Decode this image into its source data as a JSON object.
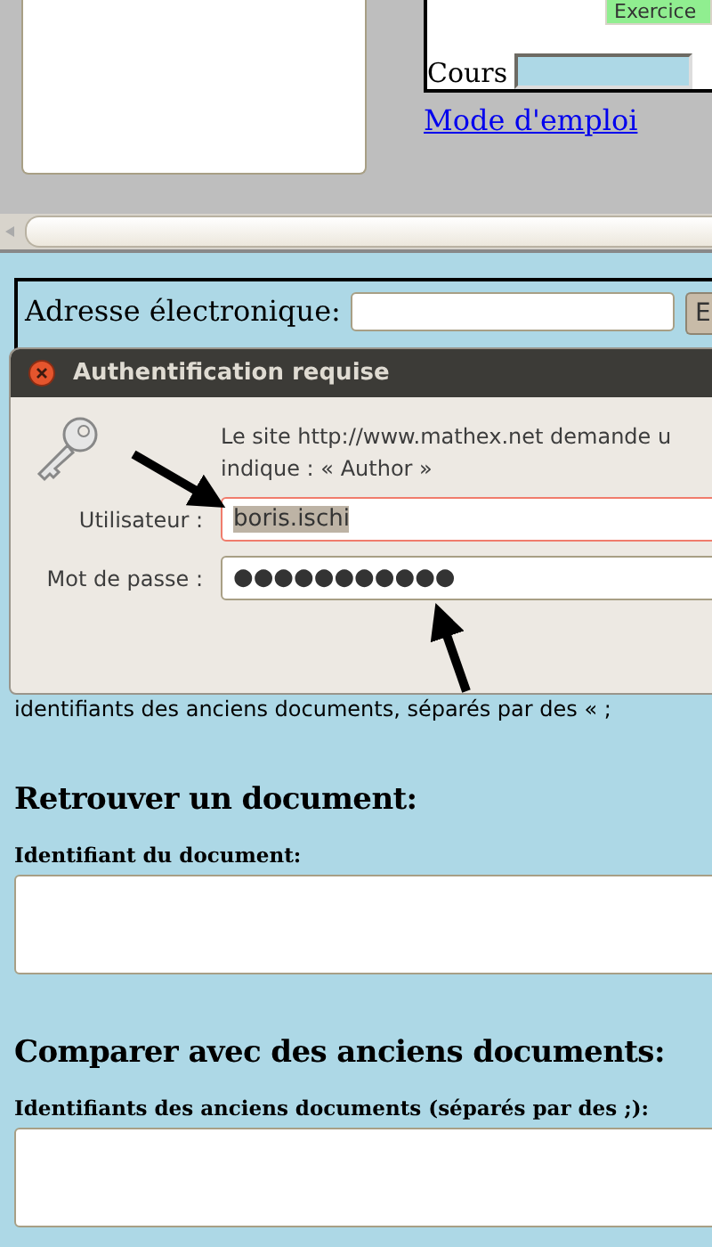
{
  "top_panel": {
    "exercise_button": "Exercice",
    "course_label": "Cours",
    "help_link": "Mode d'emploi"
  },
  "email_form": {
    "label": "Adresse électronique:",
    "button": "E"
  },
  "auth_dialog": {
    "title": "Authentification requise",
    "message": [
      "Le site http://www.mathex.net demande u",
      "indique : « Author »"
    ],
    "fields": [
      {
        "label": "Utilisateur :",
        "value": "boris.ischi",
        "focused": true
      },
      {
        "label": "Mot de passe :",
        "value": "●●●●●●●●●●●",
        "focused": false
      }
    ]
  },
  "partial_text": "identifiants des anciens documents, séparés par des « ;",
  "sections": [
    {
      "heading": "Retrouver un document:",
      "field_label": "Identifiant du document:"
    },
    {
      "heading": "Comparer avec des anciens documents:",
      "field_label": "Identifiants des anciens documents (séparés par des ;):"
    }
  ]
}
